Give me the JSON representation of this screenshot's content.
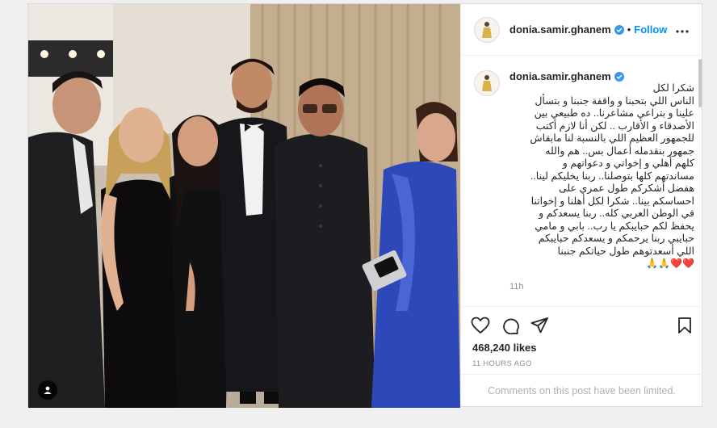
{
  "post": {
    "username": "donia.samir.ghanem",
    "follow_label": "Follow",
    "dot": "•",
    "caption_lines": [
      "شكرا لكل",
      "الناس اللي بتحبنا و واقفة جنبنا و بتسأل",
      "علينا و بتراعي مشاعرنا.. ده طبيعي بين",
      "الأصدقاء و الأقارب .. لكن أنا لازم أكتب",
      "للجمهور العظيم اللي بالنسبة لنا مابقاش",
      "جمهور بنقدمله أعمال بس.. هم والله",
      "كلهم أهلي و إخواتي و دعواتهم و",
      "مساندتهم كلها بتوصلنا.. ربنا يخليكم لينا..",
      "هفضل أشكركم طول عمري على",
      "احساسكم بينا.. شكرا لكل أهلنا و إخواتنا",
      "في الوطن العربي كله.. ربنا يسعدكم و",
      "يحفظ لكم حبايبكم يا رب.. بابي و مامي",
      "حبايبي ربنا يرحمكم و يسعدكم حبايبكم",
      "اللي أسعدتوهم طول حياتكم جنبنا"
    ],
    "caption_emojis": "❤️❤️🙏🙏",
    "caption_time": "11h",
    "likes": "468,240 likes",
    "posted_ago": "11 HOURS AGO",
    "comments_limited": "Comments on this post have been limited."
  },
  "colors": {
    "accent": "#0095f6",
    "verified": "#3897f0",
    "muted": "#8e8e8e",
    "border": "#dbdbdb",
    "heart": "#ed4956"
  },
  "icons": {
    "verified": "verified-badge-icon",
    "more": "more-options-icon",
    "like": "heart-icon",
    "comment": "comment-icon",
    "share": "paper-plane-icon",
    "save": "bookmark-icon",
    "tag": "user-tag-icon"
  }
}
